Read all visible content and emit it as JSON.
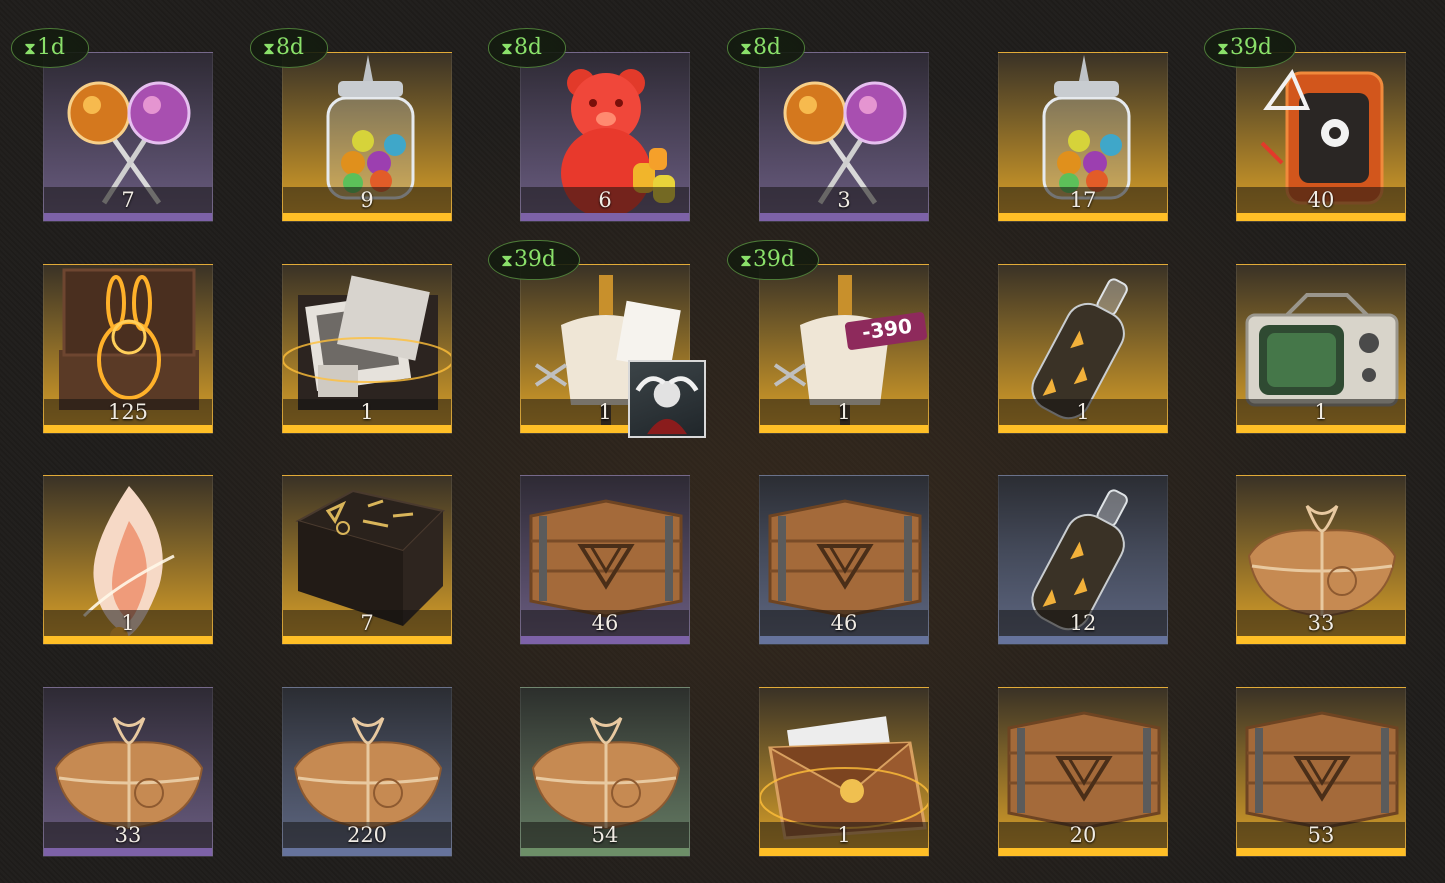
{
  "colors": {
    "rarity_purple": "#7d62a8",
    "rarity_gold": "#ffbf26",
    "rarity_blue": "#66739c",
    "rarity_green": "#6d8f68",
    "timer_text": "#8ae06a",
    "count_text": "#f1ece4"
  },
  "items": [
    {
      "name": "Lollipops",
      "icon": "lollipops-icon",
      "count": "7",
      "rarity": "purple",
      "timer": "1d"
    },
    {
      "name": "Candy Jar",
      "icon": "candy-jar-icon",
      "count": "9",
      "rarity": "gold",
      "timer": "8d"
    },
    {
      "name": "Gummy Bear",
      "icon": "gummy-bear-icon",
      "count": "6",
      "rarity": "purple",
      "timer": "8d"
    },
    {
      "name": "Lollipops",
      "icon": "lollipops-icon",
      "count": "3",
      "rarity": "purple",
      "timer": "8d"
    },
    {
      "name": "Candy Jar",
      "icon": "candy-jar-icon",
      "count": "17",
      "rarity": "gold",
      "timer": ""
    },
    {
      "name": "Orange Device",
      "icon": "orange-device-icon",
      "count": "40",
      "rarity": "gold",
      "timer": "39d"
    },
    {
      "name": "Rabbit Box",
      "icon": "rabbit-box-icon",
      "count": "125",
      "rarity": "gold",
      "timer": ""
    },
    {
      "name": "Photo Box",
      "icon": "photo-box-icon",
      "count": "1",
      "rarity": "gold",
      "timer": ""
    },
    {
      "name": "Outfit Coupon",
      "icon": "mannequin-icon",
      "count": "1",
      "rarity": "gold",
      "timer": "39d",
      "thumb": true
    },
    {
      "name": "Outfit Discount",
      "icon": "mannequin-discount-icon",
      "count": "1",
      "rarity": "gold",
      "timer": "39d",
      "badge": "-390"
    },
    {
      "name": "Bottle",
      "icon": "bottle-icon",
      "count": "1",
      "rarity": "gold",
      "timer": ""
    },
    {
      "name": "Retro TV",
      "icon": "retro-tv-icon",
      "count": "1",
      "rarity": "gold",
      "timer": ""
    },
    {
      "name": "Flame Essence",
      "icon": "flame-essence-icon",
      "count": "1",
      "rarity": "gold",
      "timer": ""
    },
    {
      "name": "Rune Table",
      "icon": "rune-table-icon",
      "count": "7",
      "rarity": "gold",
      "timer": ""
    },
    {
      "name": "Wooden Crate",
      "icon": "wooden-crate-icon",
      "count": "46",
      "rarity": "purple",
      "timer": ""
    },
    {
      "name": "Wooden Crate",
      "icon": "wooden-crate-icon",
      "count": "46",
      "rarity": "blue",
      "timer": ""
    },
    {
      "name": "Bottle",
      "icon": "bottle-icon",
      "count": "12",
      "rarity": "blue",
      "timer": ""
    },
    {
      "name": "Parcel",
      "icon": "parcel-icon",
      "count": "33",
      "rarity": "gold",
      "timer": ""
    },
    {
      "name": "Parcel",
      "icon": "parcel-icon",
      "count": "33",
      "rarity": "purple",
      "timer": ""
    },
    {
      "name": "Parcel",
      "icon": "parcel-icon",
      "count": "220",
      "rarity": "blue",
      "timer": ""
    },
    {
      "name": "Parcel",
      "icon": "parcel-icon",
      "count": "54",
      "rarity": "green",
      "timer": ""
    },
    {
      "name": "Envelope",
      "icon": "envelope-icon",
      "count": "1",
      "rarity": "gold",
      "timer": ""
    },
    {
      "name": "Wooden Crate",
      "icon": "wooden-crate-icon",
      "count": "20",
      "rarity": "gold",
      "timer": ""
    },
    {
      "name": "Wooden Crate",
      "icon": "wooden-crate-icon",
      "count": "53",
      "rarity": "gold",
      "timer": ""
    }
  ]
}
